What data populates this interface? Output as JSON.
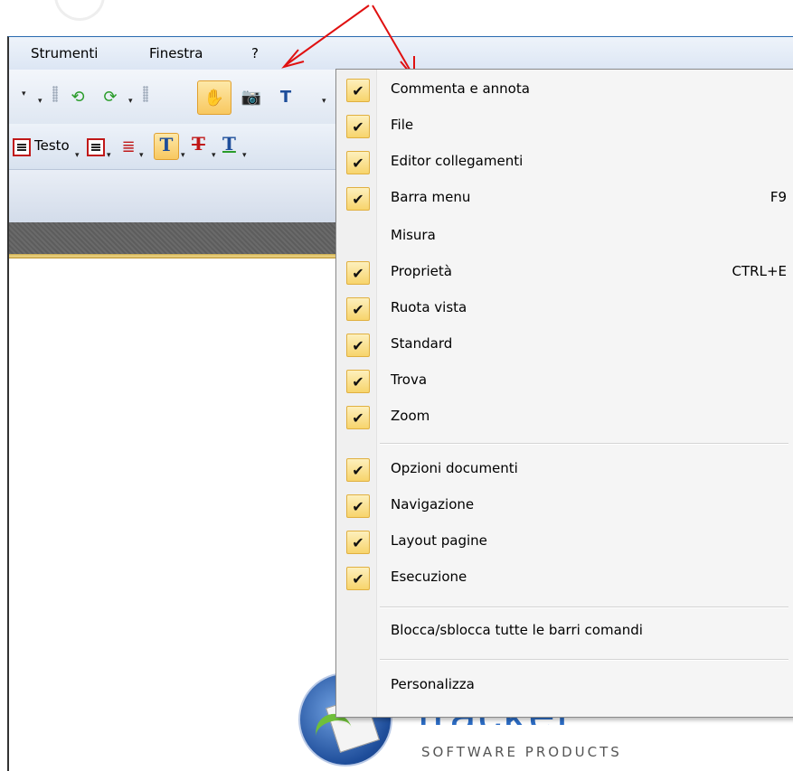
{
  "window": {
    "menubar": [
      {
        "label": "Strumenti"
      },
      {
        "label": "Finestra"
      },
      {
        "label": "?"
      }
    ],
    "toolbar_text_label": "Testo"
  },
  "menu": {
    "items": [
      {
        "label": "Commenta e annota",
        "checked": true,
        "shortcut": ""
      },
      {
        "label": "File",
        "checked": true,
        "shortcut": ""
      },
      {
        "label": "Editor collegamenti",
        "checked": true,
        "shortcut": ""
      },
      {
        "label": "Barra menu",
        "checked": true,
        "shortcut": "F9"
      },
      {
        "label": "Misura",
        "checked": false,
        "shortcut": ""
      },
      {
        "label": "Proprietà",
        "checked": true,
        "shortcut": "CTRL+E"
      },
      {
        "label": "Ruota vista",
        "checked": true,
        "shortcut": ""
      },
      {
        "label": "Standard",
        "checked": true,
        "shortcut": ""
      },
      {
        "label": "Trova",
        "checked": true,
        "shortcut": ""
      },
      {
        "label": "Zoom",
        "checked": true,
        "shortcut": ""
      },
      {
        "label": "Opzioni documenti",
        "checked": true,
        "shortcut": ""
      },
      {
        "label": "Navigazione",
        "checked": true,
        "shortcut": ""
      },
      {
        "label": "Layout pagine",
        "checked": true,
        "shortcut": ""
      },
      {
        "label": "Esecuzione",
        "checked": true,
        "shortcut": ""
      },
      {
        "label": "Blocca/sblocca tutte le barri comandi",
        "checked": false,
        "shortcut": ""
      },
      {
        "label": "Personalizza",
        "checked": false,
        "shortcut": ""
      }
    ],
    "check_glyph": "✔"
  },
  "logo": {
    "brand": "tracker",
    "subtitle": "SOFTWARE PRODUCTS"
  },
  "colors": {
    "annotation_arrow": "#e01010",
    "check_fill": "#f7d46c",
    "logo_blue": "#2c6cc4"
  }
}
